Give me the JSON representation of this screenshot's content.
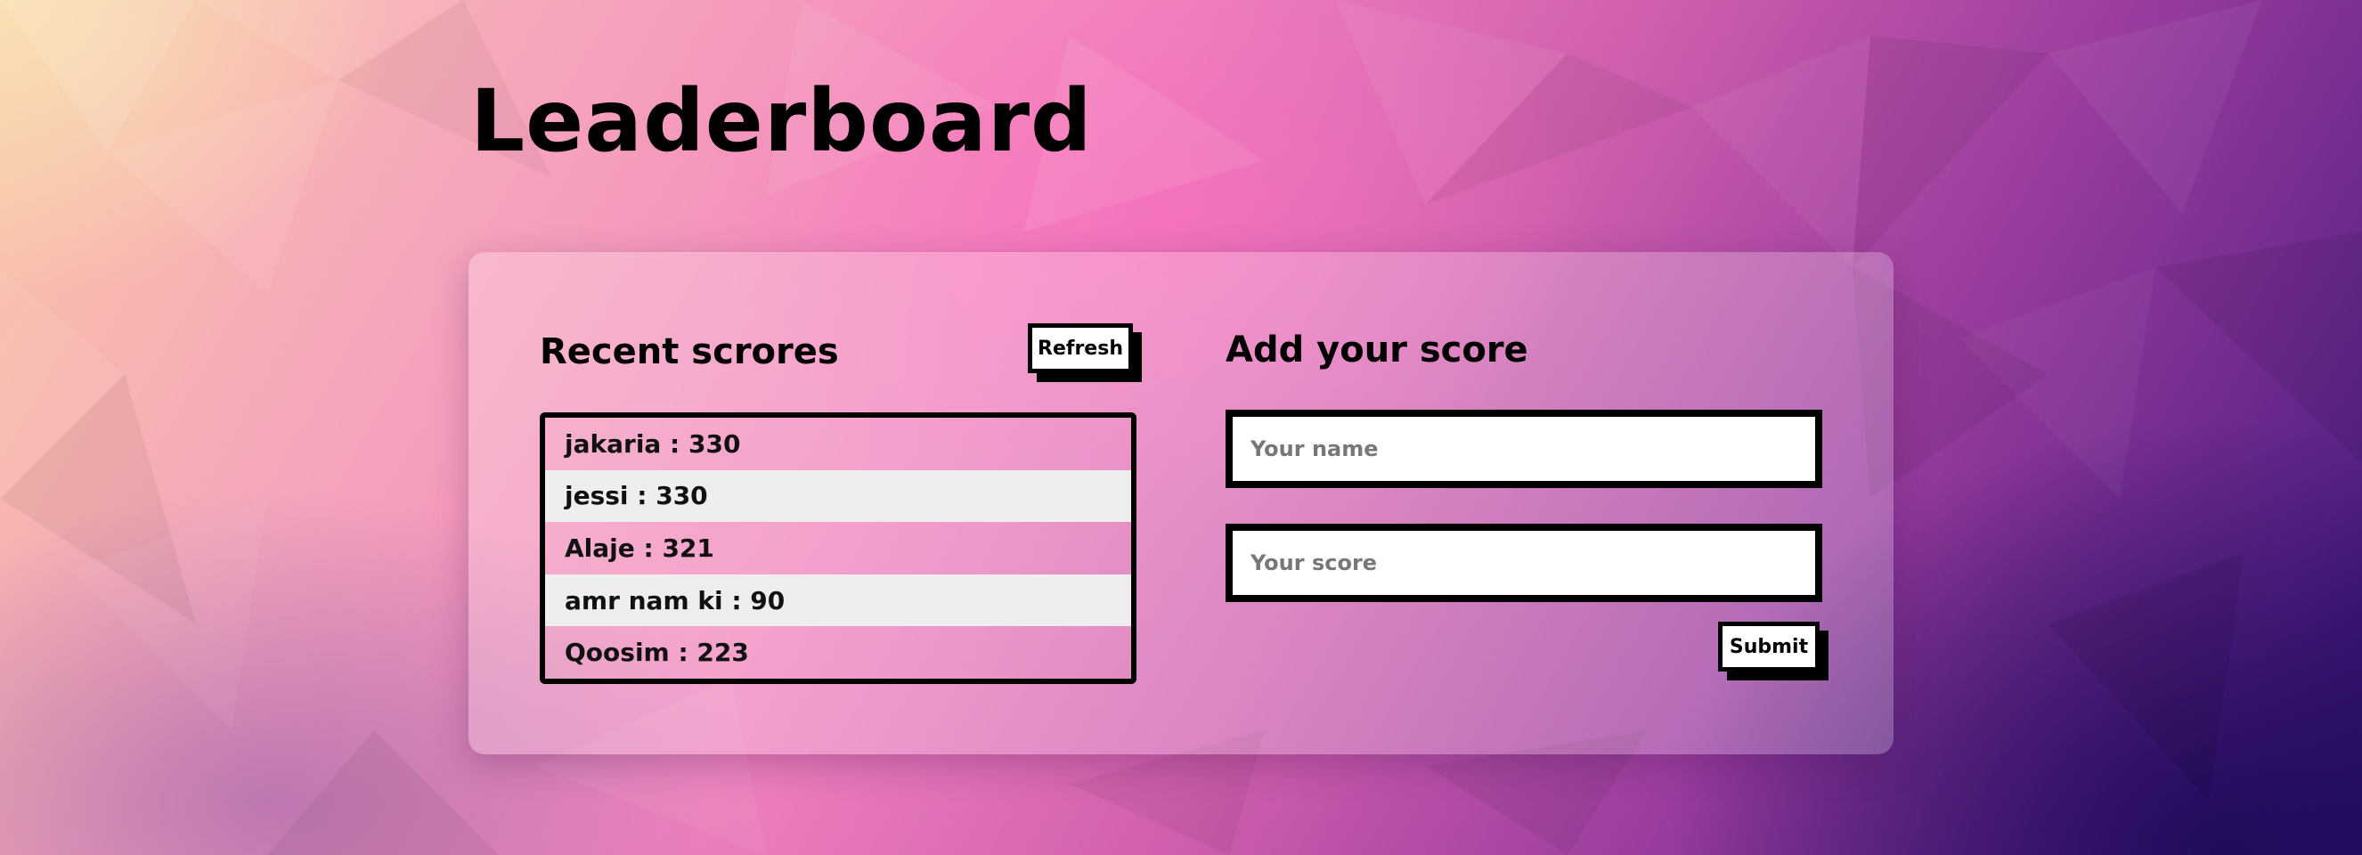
{
  "page": {
    "title": "Leaderboard"
  },
  "theme": {
    "background_colors": [
      "#f8c7a6",
      "#f183bd",
      "#9a3c9e",
      "#2c1170"
    ],
    "panel_tint": "rgba(255,255,255,0.24)",
    "row_alt_color": "#eeeeee",
    "border_color": "#000000"
  },
  "recent": {
    "title": "Recent scrores",
    "refresh_label": "Refresh",
    "scores": [
      {
        "text": "jakaria : 330"
      },
      {
        "text": "jessi : 330"
      },
      {
        "text": "Alaje : 321"
      },
      {
        "text": "amr nam ki : 90"
      },
      {
        "text": "Qoosim : 223"
      }
    ]
  },
  "add": {
    "title": "Add your score",
    "name_placeholder": "Your name",
    "score_placeholder": "Your score",
    "name_value": "",
    "score_value": "",
    "submit_label": "Submit"
  }
}
